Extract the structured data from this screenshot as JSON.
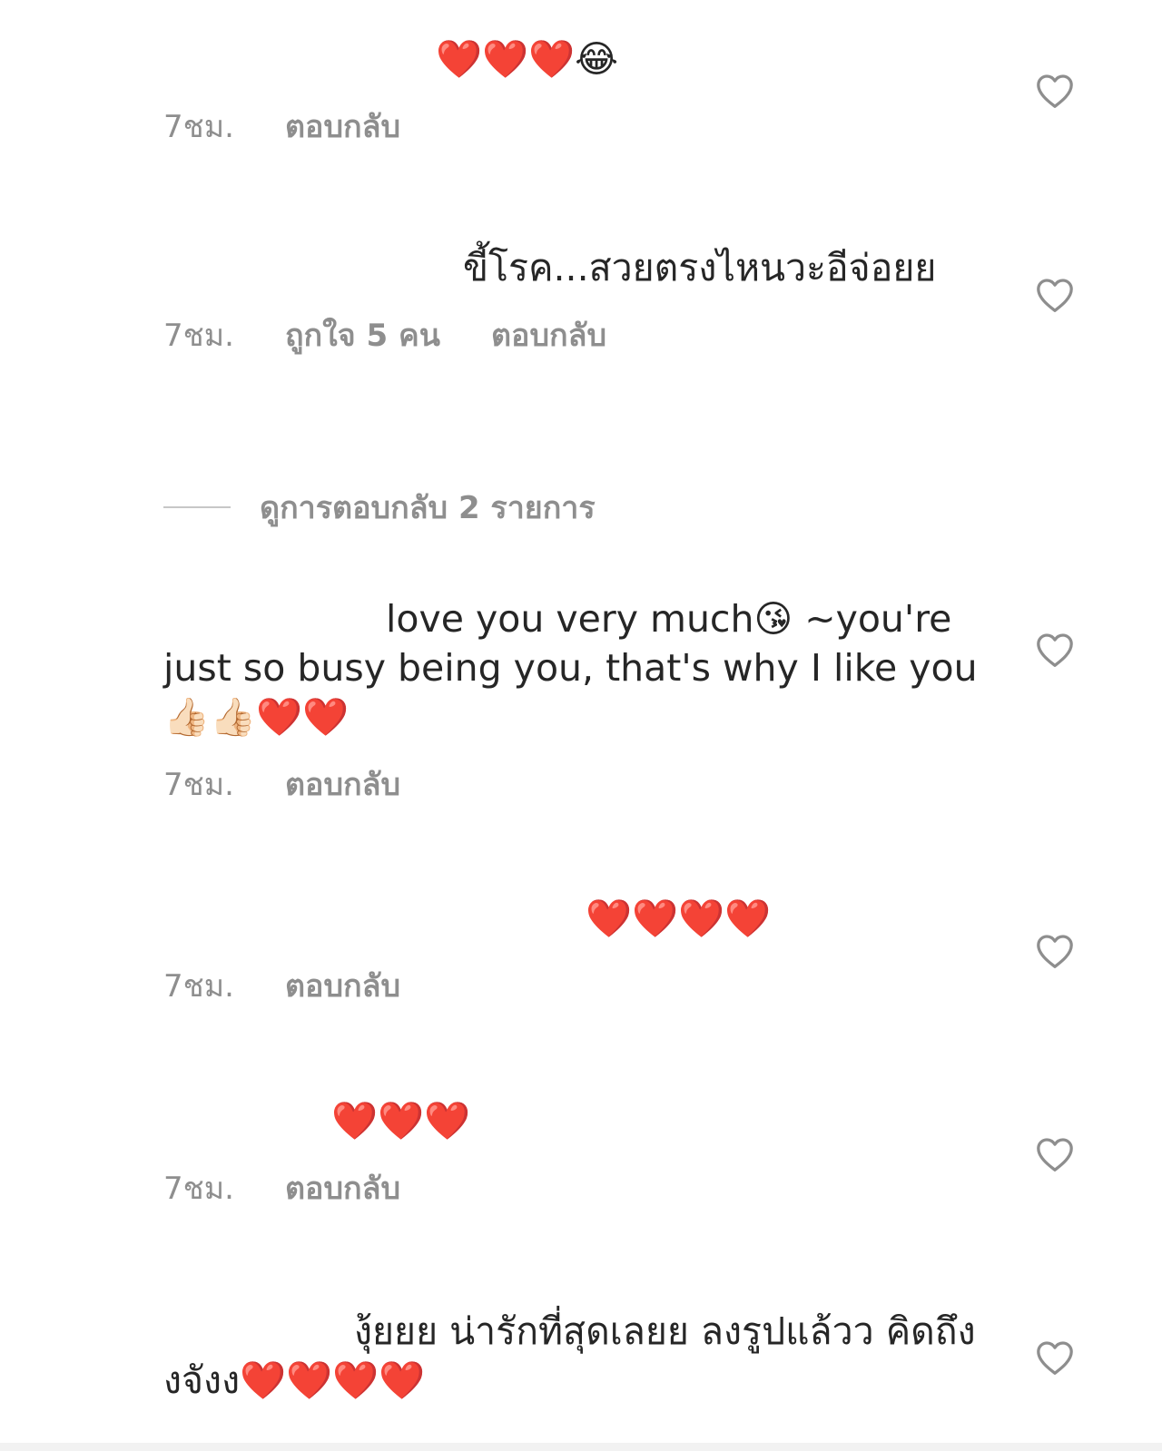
{
  "comments": [
    {
      "text": "❤️❤️❤️😂",
      "time": "7ชม.",
      "reply": "ตอบกลับ"
    },
    {
      "text": "ขี้โรค...สวยตรงไหนวะอีจ่อยย",
      "time": "7ชม.",
      "likes": "ถูกใจ 5 คน",
      "reply": "ตอบกลับ"
    },
    {
      "text": "love you very much😘 ~you're just so busy being you, that's why I like you 👍🏻👍🏻❤️❤️",
      "time": "7ชม.",
      "reply": "ตอบกลับ"
    },
    {
      "text": "❤️❤️❤️❤️",
      "time": "7ชม.",
      "reply": "ตอบกลับ"
    },
    {
      "text": "❤️❤️❤️",
      "time": "7ชม.",
      "reply": "ตอบกลับ"
    },
    {
      "text": "งุ้ยยย น่ารักที่สุดเลยย ลงรูปแล้วว คิดถึงงจังง❤️❤️❤️❤️"
    }
  ],
  "view_replies": "ดูการตอบกลับ 2 รายการ",
  "icons": {
    "like": "heart-outline-icon"
  }
}
